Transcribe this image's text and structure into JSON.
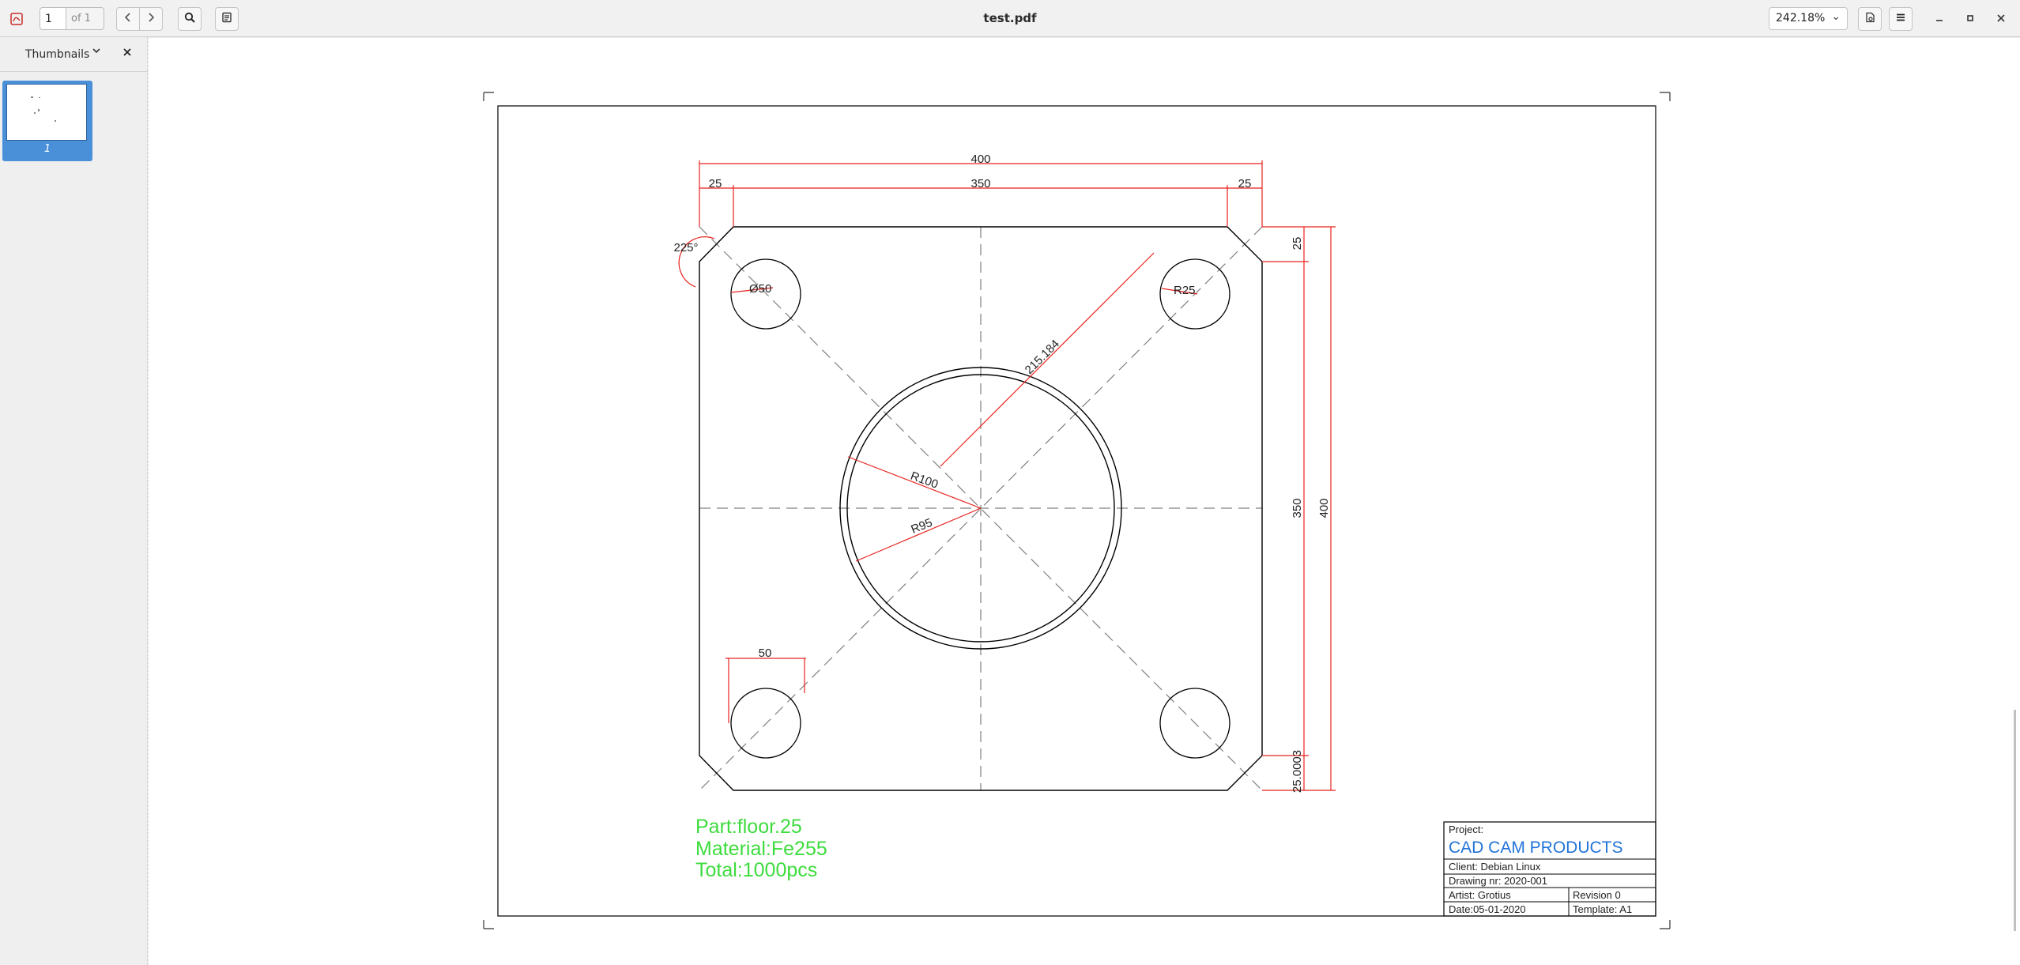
{
  "toolbar": {
    "page_number": "1",
    "page_total": "of 1",
    "document_title": "test.pdf",
    "zoom_level": "242.18%",
    "icons": [
      "pdf-app-icon",
      "previous-page-icon",
      "next-page-icon",
      "search-icon",
      "annotation-icon",
      "page-properties-icon",
      "hamburger-menu-icon",
      "minimize-icon",
      "maximize-icon",
      "close-icon"
    ]
  },
  "sidebar": {
    "title": "Thumbnails",
    "thumbnails": [
      {
        "label": "1"
      }
    ]
  },
  "drawing": {
    "dimensions": {
      "overall_width": "400",
      "inner_width": "350",
      "left_chamfer": "25",
      "right_chamfer": "25",
      "chamfer_angle": "225°",
      "hole_diameter": "Ø50",
      "hole_radius": "R25",
      "diagonal": "215.184",
      "outer_radius": "R100",
      "inner_radius": "R95",
      "hole_spacing": "50",
      "right_top_offset": "25",
      "inner_height": "350",
      "overall_height": "400",
      "bottom_offset": "25.0003"
    },
    "part_info": {
      "part": "Part:floor.25",
      "material": "Material:Fe255",
      "total": "Total:1000pcs"
    },
    "title_block": {
      "project_label": "Project:",
      "company": "CAD CAM PRODUCTS",
      "client": "Client: Debian Linux",
      "drawing_nr": "Drawing nr: 2020-001",
      "artist": "Artist: Grotius",
      "revision": "Revision   0",
      "date": "Date:05-01-2020",
      "template": "Template: A1"
    },
    "colors": {
      "outline": "#000000",
      "dimension": "#e8221e",
      "centerline": "#808080",
      "part_text": "#3ddc3d",
      "company_text": "#2273d8"
    }
  }
}
